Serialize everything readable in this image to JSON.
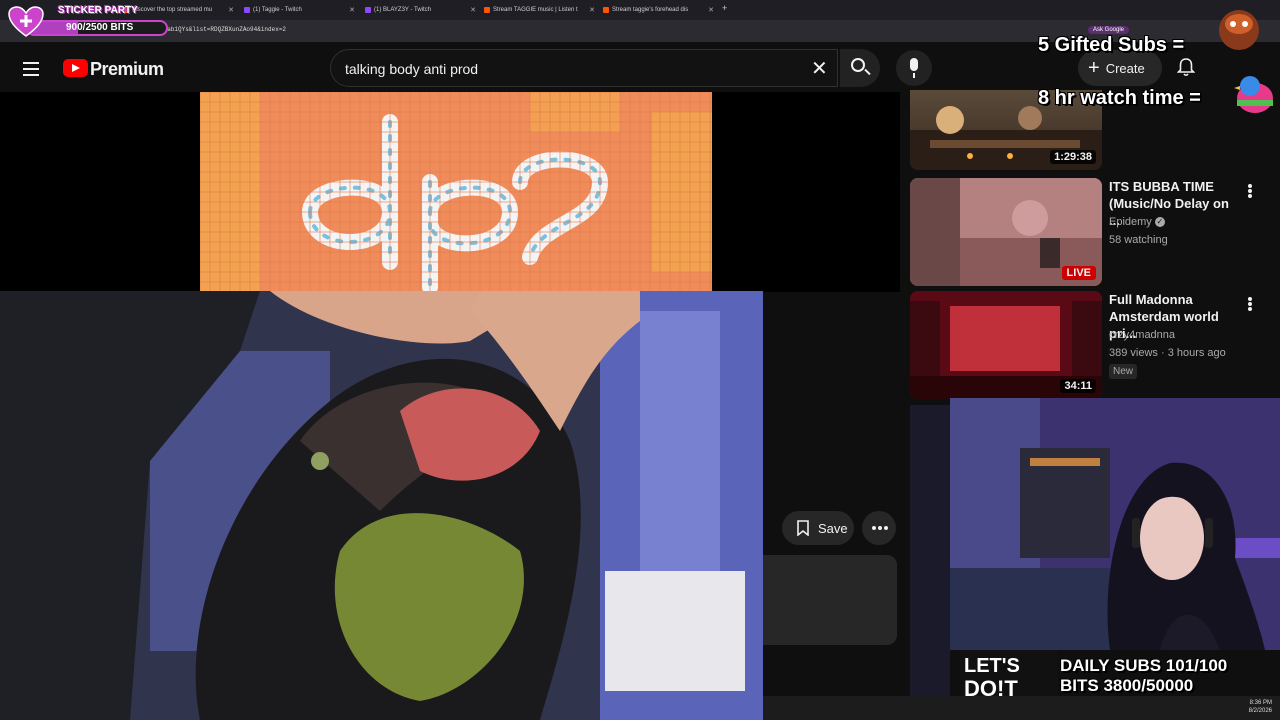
{
  "browser": {
    "tabs": [
      {
        "title": "Discover the top streamed mu",
        "color": "#ff5500"
      },
      {
        "title": "(1) Taggie - Twitch",
        "color": "#9146ff"
      },
      {
        "title": "(1) BLAYZ3Y - Twitch",
        "color": "#9146ff"
      },
      {
        "title": "Stream TAGGIE music | Listen t",
        "color": "#ff5500"
      },
      {
        "title": "Stream taggie's forehead dis",
        "color": "#ff5500"
      }
    ],
    "url": "llab1QYs&list=RDQZBXunZAo94&index=2",
    "ask_google": "Ask Google"
  },
  "header": {
    "brand": "Premium",
    "search_value": "talking body  anti prod",
    "create_label": "Create"
  },
  "actions": {
    "save_label": "Save"
  },
  "recommendations": [
    {
      "title": "",
      "channel": "",
      "meta": "",
      "duration": "1:29:38",
      "thumb": "#7a5a3a"
    },
    {
      "title": "ITS BUBBA TIME (Music/No Delay on ...",
      "channel": "Epidemy",
      "meta": "58 watching",
      "badge": "LIVE",
      "thumb": "#b07a7a"
    },
    {
      "title": "Full Madonna Amsterdam world pri...",
      "channel": "crzy4madnna",
      "meta": "389 views · 3 hours ago",
      "duration": "34:11",
      "new": "New",
      "thumb": "#8a1a2a"
    }
  ],
  "overlay": {
    "sticker_label": "STICKER PARTY",
    "sticker_count": "900/2500 BITS",
    "sticker_progress": 0.36,
    "gifted_subs": "5 Gifted Subs =",
    "watch_time": "8 hr watch time =",
    "daily_subs": "DAILY SUBS 101/100",
    "bits": "BITS 3800/50000"
  },
  "clock": {
    "time": "8:36 PM",
    "date": "8/2/2026"
  },
  "colors": {
    "accent": "#ff0000",
    "live": "#cc0000",
    "twitch": "#9146ff"
  }
}
